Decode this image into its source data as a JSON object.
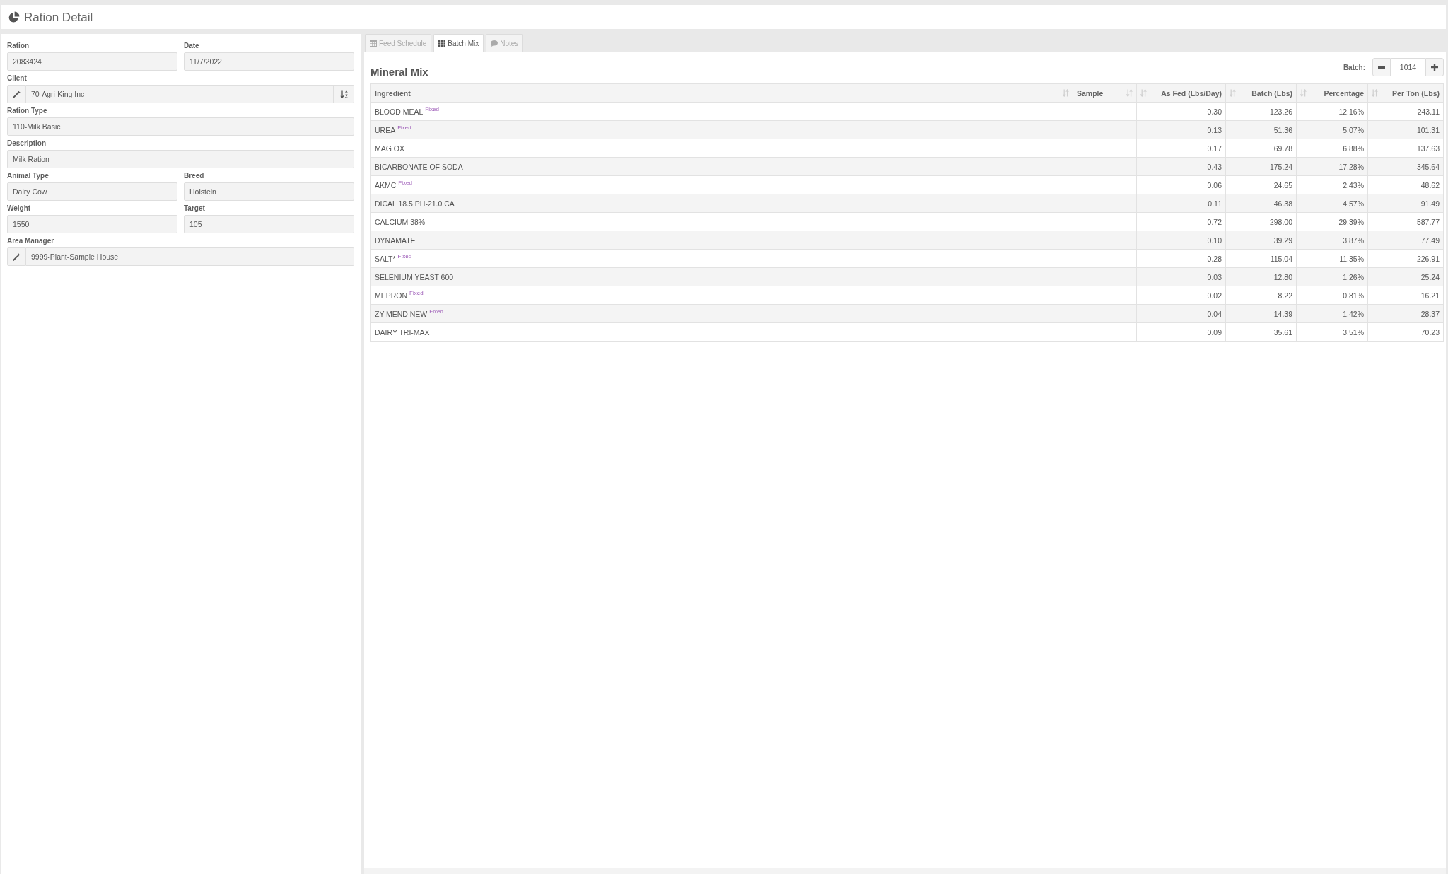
{
  "page_header": {
    "title": "Ration Detail"
  },
  "form": {
    "rows": [
      [
        {
          "label": "Ration",
          "value": "2083424",
          "kind": "text"
        },
        {
          "label": "Date",
          "value": "11/7/2022",
          "kind": "text"
        }
      ],
      [
        {
          "label": "Client",
          "value": "70-Agri-King Inc",
          "kind": "lookup_sort"
        }
      ],
      [
        {
          "label": "Ration Type",
          "value": "110-Milk Basic",
          "kind": "text"
        }
      ],
      [
        {
          "label": "Description",
          "value": "Milk Ration",
          "kind": "text"
        }
      ],
      [
        {
          "label": "Animal Type",
          "value": "Dairy Cow",
          "kind": "text"
        },
        {
          "label": "Breed",
          "value": "Holstein",
          "kind": "text"
        }
      ],
      [
        {
          "label": "Weight",
          "value": "1550",
          "kind": "text"
        },
        {
          "label": "Target",
          "value": "105",
          "kind": "text"
        }
      ],
      [
        {
          "label": "Area Manager",
          "value": "9999-Plant-Sample House",
          "kind": "lookup"
        }
      ]
    ]
  },
  "tabs": [
    {
      "label": "Feed Schedule",
      "selected": false
    },
    {
      "label": "Batch Mix",
      "selected": true
    },
    {
      "label": "Notes",
      "selected": false
    }
  ],
  "batch_mix": {
    "title": "Mineral Mix",
    "batch": {
      "label": "Batch:",
      "value": "1014"
    },
    "table": {
      "columns": [
        {
          "label": "Ingredient",
          "kind": "text"
        },
        {
          "label": "Sample",
          "kind": "text"
        },
        {
          "label": "As Fed (Lbs/Day)",
          "kind": "number"
        },
        {
          "label": "Batch (Lbs)",
          "kind": "number"
        },
        {
          "label": "Percentage",
          "kind": "number"
        },
        {
          "label": "Per Ton (Lbs)",
          "kind": "number"
        }
      ],
      "rows": [
        {
          "ingredient": "BLOOD MEAL",
          "tag": "Fixed",
          "values": [
            "0.30",
            "123.26",
            "12.16%",
            "243.11"
          ]
        },
        {
          "ingredient": "UREA",
          "tag": "Fixed",
          "values": [
            "0.13",
            "51.36",
            "5.07%",
            "101.31"
          ]
        },
        {
          "ingredient": "MAG OX",
          "values": [
            "0.17",
            "69.78",
            "6.88%",
            "137.63"
          ]
        },
        {
          "ingredient": "BICARBONATE OF SODA",
          "values": [
            "0.43",
            "175.24",
            "17.28%",
            "345.64"
          ]
        },
        {
          "ingredient": "AKMC",
          "tag": "Fixed",
          "values": [
            "0.06",
            "24.65",
            "2.43%",
            "48.62"
          ]
        },
        {
          "ingredient": "DICAL 18.5 PH-21.0 CA",
          "values": [
            "0.11",
            "46.38",
            "4.57%",
            "91.49"
          ]
        },
        {
          "ingredient": "CALCIUM 38%",
          "values": [
            "0.72",
            "298.00",
            "29.39%",
            "587.77"
          ]
        },
        {
          "ingredient": "DYNAMATE",
          "values": [
            "0.10",
            "39.29",
            "3.87%",
            "77.49"
          ]
        },
        {
          "ingredient": "SALT*",
          "tag": "Fixed",
          "values": [
            "0.28",
            "115.04",
            "11.35%",
            "226.91"
          ]
        },
        {
          "ingredient": "SELENIUM YEAST 600",
          "values": [
            "0.03",
            "12.80",
            "1.26%",
            "25.24"
          ]
        },
        {
          "ingredient": "MEPRON",
          "tag": "Fixed",
          "values": [
            "0.02",
            "8.22",
            "0.81%",
            "16.21"
          ]
        },
        {
          "ingredient": "ZY-MEND NEW",
          "tag": "Fixed",
          "values": [
            "0.04",
            "14.39",
            "1.42%",
            "28.37"
          ]
        },
        {
          "ingredient": "DAIRY TRI-MAX",
          "values": [
            "0.09",
            "35.61",
            "3.51%",
            "70.23"
          ]
        }
      ]
    }
  }
}
